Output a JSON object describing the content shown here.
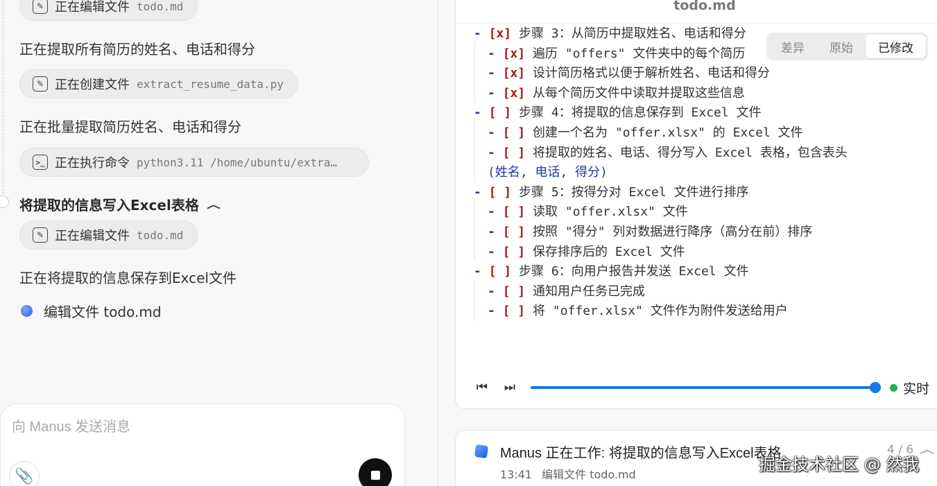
{
  "sidebar": {
    "chips": [
      {
        "action": "正在编辑文件",
        "arg": "todo.md",
        "icon": "edit-icon"
      },
      {
        "action": "正在创建文件",
        "arg": "extract_resume_data.py",
        "icon": "edit-icon"
      },
      {
        "action": "正在执行命令",
        "arg": "python3.11 /home/ubuntu/extra…",
        "icon": "terminal-icon"
      },
      {
        "action": "正在编辑文件",
        "arg": "todo.md",
        "icon": "edit-icon"
      }
    ],
    "messages": [
      "正在提取所有简历的姓名、电话和得分",
      "正在批量提取简历姓名、电话和得分",
      "正在将提取的信息保存到Excel文件"
    ],
    "step_title": "将提取的信息写入Excel表格",
    "live_action": "编辑文件 todo.md"
  },
  "composer": {
    "placeholder": "向 Manus 发送消息"
  },
  "viewer": {
    "title": "todo.md",
    "tabs": [
      "差异",
      "原始",
      "已修改"
    ],
    "active_tab": "已修改",
    "lines": [
      {
        "prefix": "- ",
        "box": "[x]",
        "text": " 步骤 3：从简历中提取姓名、电话和得分"
      },
      {
        "prefix": "  - ",
        "box": "[x]",
        "text": " 遍历 \"offers\" 文件夹中的每个简历"
      },
      {
        "prefix": "  - ",
        "box": "[x]",
        "text": " 设计简历格式以便于解析姓名、电话和得分"
      },
      {
        "prefix": "  - ",
        "box": "[x]",
        "text": " 从每个简历文件中读取并提取这些信息"
      },
      {
        "prefix": "- ",
        "box": "[ ]",
        "text": " 步骤 4：将提取的信息保存到 Excel 文件"
      },
      {
        "prefix": "  - ",
        "box": "[ ]",
        "text": " 创建一个名为 \"offer.xlsx\" 的 Excel 文件"
      },
      {
        "prefix": "  - ",
        "box": "[ ]",
        "text": " 将提取的姓名、电话、得分写入 Excel 表格，包含表头"
      },
      {
        "prefix": "",
        "box": "",
        "text": "  (姓名, 电话, 得分)"
      },
      {
        "prefix": "- ",
        "box": "[ ]",
        "text": " 步骤 5：按得分对 Excel 文件进行排序"
      },
      {
        "prefix": "  - ",
        "box": "[ ]",
        "text": " 读取 \"offer.xlsx\" 文件"
      },
      {
        "prefix": "  - ",
        "box": "[ ]",
        "text": " 按照 \"得分\" 列对数据进行降序（高分在前）排序"
      },
      {
        "prefix": "  - ",
        "box": "[ ]",
        "text": " 保存排序后的 Excel 文件"
      },
      {
        "prefix": "- ",
        "box": "[ ]",
        "text": " 步骤 6：向用户报告并发送 Excel 文件"
      },
      {
        "prefix": "  - ",
        "box": "[ ]",
        "text": " 通知用户任务已完成"
      },
      {
        "prefix": "  - ",
        "box": "[ ]",
        "text": " 将 \"offer.xlsx\" 文件作为附件发送给用户"
      }
    ],
    "progress": 1.0,
    "live_label": "实时"
  },
  "status": {
    "title": "Manus 正在工作: 将提取的信息写入Excel表格",
    "count": "4 / 6",
    "time": "13:41",
    "tool": "编辑文件 todo.md"
  },
  "watermark": "掘金技术社区 @ 然我",
  "colors": {
    "accent": "#1677e6",
    "live": "#22b14c",
    "checkbox": "#a11b1b",
    "list_marker": "#1e3aa8"
  }
}
